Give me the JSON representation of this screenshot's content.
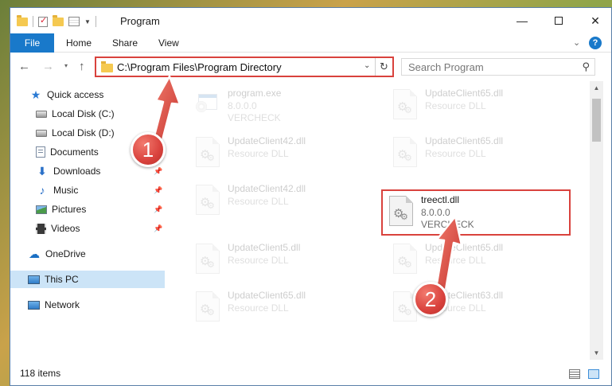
{
  "window": {
    "title": "Program",
    "controls": {
      "minimize": "—",
      "maximize": "",
      "close": "✕"
    }
  },
  "ribbon": {
    "tabs": [
      "File",
      "Home",
      "Share",
      "View"
    ],
    "collapse": "⌄",
    "help": "?"
  },
  "navigation": {
    "back": "←",
    "forward": "→",
    "recent": "▾",
    "up": "↑",
    "address_path": "C:\\Program Files\\Program Directory",
    "address_dropdown": "⌄",
    "refresh": "↻",
    "search_placeholder": "Search Program",
    "search_icon": "⚲"
  },
  "sidebar": {
    "items": [
      {
        "label": "Quick access",
        "icon": "star-icon",
        "pinned": false
      },
      {
        "label": "Local Disk (C:)",
        "icon": "drive-icon",
        "pinned": false
      },
      {
        "label": "Local Disk (D:)",
        "icon": "drive-icon",
        "pinned": false
      },
      {
        "label": "Documents",
        "icon": "documents-icon",
        "pinned": true
      },
      {
        "label": "Downloads",
        "icon": "download-arrow-icon",
        "pinned": true
      },
      {
        "label": "Music",
        "icon": "music-note-icon",
        "pinned": true
      },
      {
        "label": "Pictures",
        "icon": "pictures-icon",
        "pinned": true
      },
      {
        "label": "Videos",
        "icon": "film-icon",
        "pinned": true
      },
      {
        "label": "OneDrive",
        "icon": "cloud-icon",
        "pinned": false
      },
      {
        "label": "This PC",
        "icon": "computer-icon",
        "pinned": false,
        "selected": true
      },
      {
        "label": "Network",
        "icon": "network-icon",
        "pinned": false
      }
    ],
    "pin_glyph": "📌"
  },
  "files": [
    {
      "name": "program.exe",
      "line1": "8.0.0.0",
      "line2": "VERCHECK",
      "kind": "exe",
      "faded": true
    },
    {
      "name": "UpdateClient65.dll",
      "line1": "Resource DLL",
      "line2": "",
      "kind": "dll",
      "faded": true
    },
    {
      "name": "UpdateClient42.dll",
      "line1": "Resource DLL",
      "line2": "",
      "kind": "dll",
      "faded": true
    },
    {
      "name": "UpdateClient65.dll",
      "line1": "Resource DLL",
      "line2": "",
      "kind": "dll",
      "faded": true
    },
    {
      "name": "UpdateClient42.dll",
      "line1": "Resource DLL",
      "line2": "",
      "kind": "dll",
      "faded": true
    },
    {
      "name": "treectl.dll",
      "line1": "8.0.0.0",
      "line2": "VERCHECK",
      "kind": "dll",
      "faded": false,
      "highlighted": true
    },
    {
      "name": "UpdateClient5.dll",
      "line1": "Resource DLL",
      "line2": "",
      "kind": "dll",
      "faded": true
    },
    {
      "name": "UpdateClient65.dll",
      "line1": "Resource DLL",
      "line2": "",
      "kind": "dll",
      "faded": true
    },
    {
      "name": "UpdateClient65.dll",
      "line1": "Resource DLL",
      "line2": "",
      "kind": "dll",
      "faded": true
    },
    {
      "name": "UpdateClient63.dll",
      "line1": "Resource DLL",
      "line2": "",
      "kind": "dll",
      "faded": true
    }
  ],
  "status": {
    "item_count": "118 items"
  },
  "annotations": {
    "step1": "1",
    "step2": "2",
    "color": "#d9423d"
  },
  "colors": {
    "accent": "#1979ca",
    "selection": "#cce4f7",
    "highlight_box": "#d9423d"
  }
}
